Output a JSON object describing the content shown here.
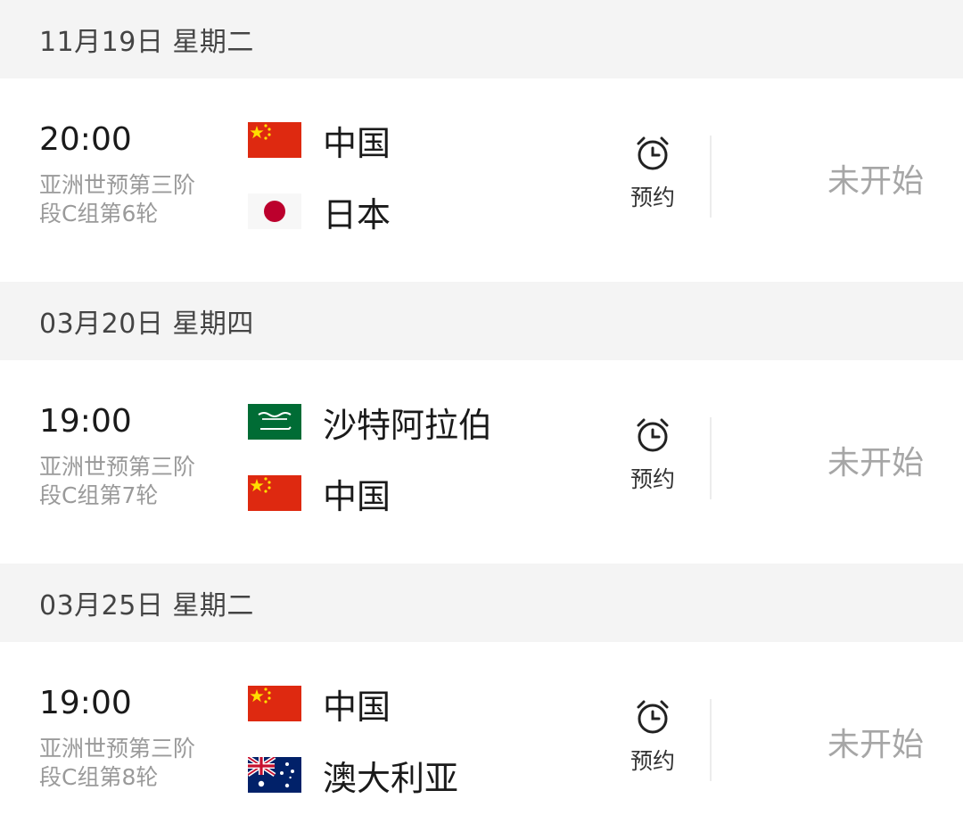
{
  "groups": [
    {
      "date": "11月19日 星期二",
      "match": {
        "time": "20:00",
        "stage": "亚洲世预第三阶段C组第6轮",
        "home": {
          "name": "中国",
          "flag": "china-flag-icon"
        },
        "away": {
          "name": "日本",
          "flag": "japan-flag-icon"
        },
        "remind_label": "预约",
        "status": "未开始"
      }
    },
    {
      "date": "03月20日 星期四",
      "match": {
        "time": "19:00",
        "stage": "亚洲世预第三阶段C组第7轮",
        "home": {
          "name": "沙特阿拉伯",
          "flag": "saudi-arabia-flag-icon"
        },
        "away": {
          "name": "中国",
          "flag": "china-flag-icon"
        },
        "remind_label": "预约",
        "status": "未开始"
      }
    },
    {
      "date": "03月25日 星期二",
      "match": {
        "time": "19:00",
        "stage": "亚洲世预第三阶段C组第8轮",
        "home": {
          "name": "中国",
          "flag": "china-flag-icon"
        },
        "away": {
          "name": "澳大利亚",
          "flag": "australia-flag-icon"
        },
        "remind_label": "预约",
        "status": "未开始"
      }
    }
  ],
  "colors": {
    "header_bg": "#f4f4f4",
    "china_red": "#de2910",
    "china_star": "#ffde00",
    "japan_red": "#bc002d",
    "saudi_green": "#006c35",
    "australia_blue": "#012169",
    "status_gray": "#a6a6a6"
  }
}
